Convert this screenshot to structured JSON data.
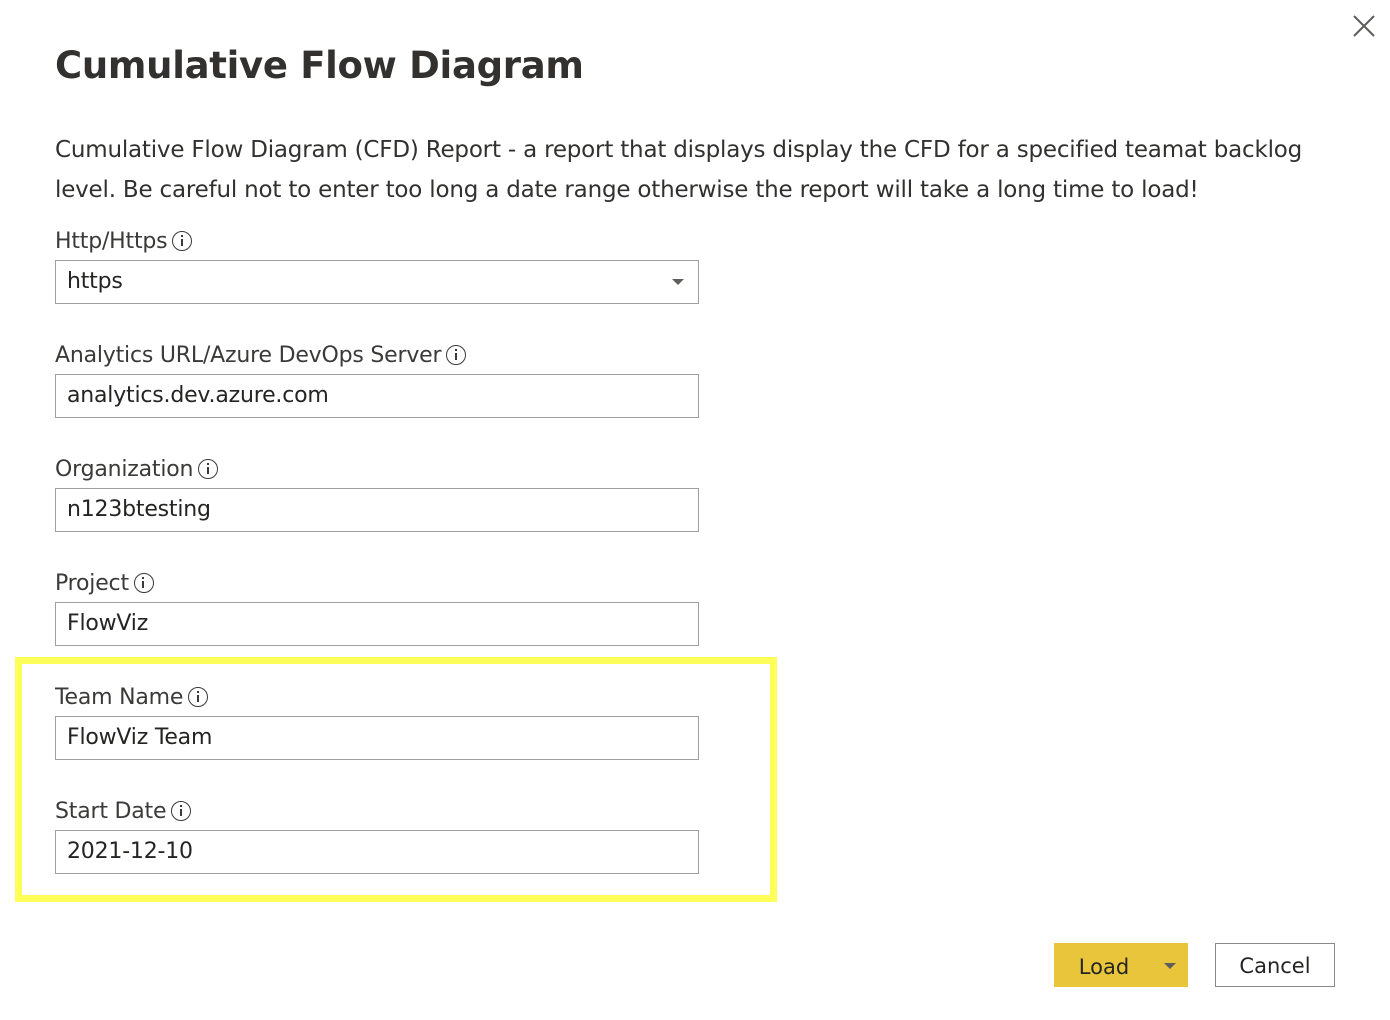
{
  "dialog": {
    "title": "Cumulative Flow Diagram",
    "description": "Cumulative Flow Diagram (CFD) Report - a report that displays display the CFD for a specified teamat backlog level. Be careful not to enter too long a date range otherwise the report will take a long time to load!",
    "close_icon": "close-icon"
  },
  "fields": {
    "protocol": {
      "label": "Http/Https",
      "value": "https",
      "icon": "info-icon"
    },
    "analytics_url": {
      "label": "Analytics URL/Azure DevOps Server",
      "value": "analytics.dev.azure.com",
      "icon": "info-icon"
    },
    "organization": {
      "label": "Organization",
      "value": "n123btesting",
      "icon": "info-icon"
    },
    "project": {
      "label": "Project",
      "value": "FlowViz",
      "icon": "info-icon"
    },
    "team_name": {
      "label": "Team Name",
      "value": "FlowViz Team",
      "icon": "info-icon"
    },
    "start_date": {
      "label": "Start Date",
      "value": "2021-12-10",
      "icon": "info-icon"
    }
  },
  "buttons": {
    "load_label": "Load",
    "cancel_label": "Cancel"
  },
  "colors": {
    "highlight": "#ffff5a",
    "primary_button": "#e8c53a"
  }
}
